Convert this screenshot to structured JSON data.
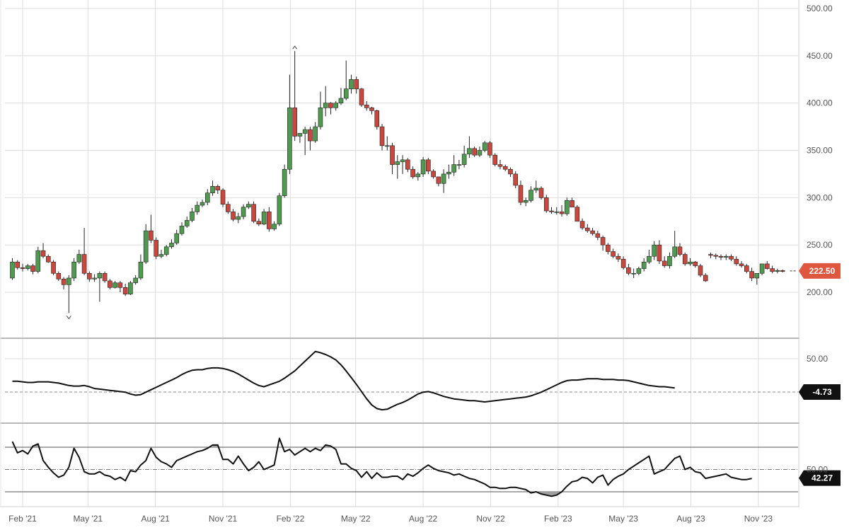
{
  "chart_data": [
    {
      "type": "candlestick",
      "name": "price-panel",
      "ylim": [
        200,
        500
      ],
      "yticks": [
        "500.00",
        "450.00",
        "400.00",
        "350.00",
        "300.00",
        "250.00",
        "200.00"
      ],
      "grid": true,
      "last_value": 222.5,
      "last_label": "222.50",
      "colors": {
        "up": "#4e9a4e",
        "down": "#c9473d",
        "wick": "#222222",
        "badge": "#e0573f"
      },
      "x": [
        "2021-01-18",
        "2021-01-25",
        "2021-02-01",
        "2021-02-08",
        "2021-02-15",
        "2021-02-22",
        "2021-03-01",
        "2021-03-08",
        "2021-03-15",
        "2021-03-22",
        "2021-03-29",
        "2021-04-05",
        "2021-04-12",
        "2021-04-19",
        "2021-04-26",
        "2021-05-03",
        "2021-05-10",
        "2021-05-17",
        "2021-05-24",
        "2021-05-31",
        "2021-06-07",
        "2021-06-14",
        "2021-06-21",
        "2021-06-28",
        "2021-07-05",
        "2021-07-12",
        "2021-07-19",
        "2021-07-26",
        "2021-08-02",
        "2021-08-09",
        "2021-08-16",
        "2021-08-23",
        "2021-08-30",
        "2021-09-06",
        "2021-09-13",
        "2021-09-20",
        "2021-09-27",
        "2021-10-04",
        "2021-10-11",
        "2021-10-18",
        "2021-10-25",
        "2021-11-01",
        "2021-11-08",
        "2021-11-15",
        "2021-11-22",
        "2021-11-29",
        "2021-12-06",
        "2021-12-13",
        "2021-12-20",
        "2021-12-27",
        "2022-01-03",
        "2022-01-10",
        "2022-01-17",
        "2022-01-24",
        "2022-01-31",
        "2022-02-07",
        "2022-02-14",
        "2022-02-21",
        "2022-02-28",
        "2022-03-07",
        "2022-03-14",
        "2022-03-21",
        "2022-03-28",
        "2022-04-04",
        "2022-04-11",
        "2022-04-18",
        "2022-04-25",
        "2022-05-02",
        "2022-05-09",
        "2022-05-16",
        "2022-05-23",
        "2022-05-30",
        "2022-06-06",
        "2022-06-13",
        "2022-06-20",
        "2022-06-27",
        "2022-07-04",
        "2022-07-11",
        "2022-07-18",
        "2022-07-25",
        "2022-08-01",
        "2022-08-08",
        "2022-08-15",
        "2022-08-22",
        "2022-08-29",
        "2022-09-05",
        "2022-09-12",
        "2022-09-19",
        "2022-09-26",
        "2022-10-03",
        "2022-10-10",
        "2022-10-17",
        "2022-10-24",
        "2022-10-31",
        "2022-11-07",
        "2022-11-14",
        "2022-11-21",
        "2022-11-28",
        "2022-12-05",
        "2022-12-12",
        "2022-12-19",
        "2022-12-26",
        "2023-01-02",
        "2023-01-09",
        "2023-01-16",
        "2023-01-23",
        "2023-01-30",
        "2023-02-06",
        "2023-02-13",
        "2023-02-20",
        "2023-02-27",
        "2023-03-06",
        "2023-03-13",
        "2023-03-20",
        "2023-03-27",
        "2023-04-03",
        "2023-04-10",
        "2023-04-17",
        "2023-04-24",
        "2023-05-01",
        "2023-05-08",
        "2023-05-15",
        "2023-05-22",
        "2023-05-29",
        "2023-06-05",
        "2023-06-12",
        "2023-06-19",
        "2023-06-26",
        "2023-07-03",
        "2023-07-10",
        "2023-07-17",
        "2023-07-24",
        "2023-07-31",
        "2023-08-07",
        "2023-08-14",
        "2023-08-21",
        "2023-08-28",
        "2023-09-04",
        "2023-09-11",
        "2023-09-18",
        "2023-09-25",
        "2023-10-02",
        "2023-10-09",
        "2023-10-16",
        "2023-10-23",
        "2023-10-30",
        "2023-11-06",
        "2023-11-13",
        "2023-11-20",
        "2023-11-27",
        "2023-12-04",
        "2023-12-11",
        "2023-12-18"
      ],
      "open": [
        215,
        232,
        226,
        225,
        228,
        222,
        244,
        238,
        232,
        220,
        214,
        208,
        215,
        232,
        240,
        220,
        214,
        215,
        220,
        212,
        205,
        210,
        205,
        198,
        210,
        215,
        232,
        265,
        255,
        238,
        240,
        248,
        252,
        262,
        270,
        276,
        285,
        292,
        295,
        305,
        312,
        308,
        293,
        285,
        277,
        280,
        290,
        293,
        275,
        272,
        285,
        267,
        272,
        302,
        330,
        395,
        365,
        368,
        372,
        360,
        375,
        395,
        400,
        395,
        400,
        405,
        415,
        425,
        415,
        398,
        395,
        392,
        375,
        355,
        355,
        335,
        338,
        340,
        330,
        322,
        325,
        340,
        328,
        322,
        315,
        325,
        327,
        335,
        335,
        346,
        352,
        345,
        350,
        358,
        345,
        335,
        333,
        330,
        325,
        313,
        295,
        297,
        308,
        310,
        300,
        286,
        285,
        285,
        283,
        297,
        290,
        275,
        268,
        265,
        262,
        258,
        250,
        243,
        238,
        235,
        226,
        220,
        220,
        225,
        232,
        238,
        250,
        233,
        228,
        238,
        248,
        240,
        230,
        232,
        228,
        218,
        240,
        239,
        238,
        237,
        238,
        235,
        230,
        228,
        222,
        215,
        220,
        230,
        225,
        222,
        223
      ],
      "close": [
        232,
        226,
        225,
        228,
        222,
        244,
        238,
        232,
        220,
        214,
        208,
        215,
        232,
        240,
        220,
        214,
        215,
        220,
        212,
        205,
        210,
        205,
        198,
        210,
        215,
        232,
        265,
        255,
        238,
        240,
        248,
        252,
        262,
        270,
        276,
        285,
        292,
        295,
        305,
        312,
        308,
        293,
        285,
        277,
        280,
        290,
        293,
        275,
        272,
        285,
        267,
        272,
        302,
        330,
        395,
        365,
        368,
        372,
        360,
        375,
        395,
        400,
        395,
        400,
        405,
        415,
        425,
        415,
        398,
        395,
        392,
        375,
        355,
        355,
        335,
        338,
        340,
        330,
        322,
        325,
        340,
        328,
        322,
        315,
        325,
        327,
        335,
        335,
        346,
        352,
        345,
        350,
        358,
        345,
        335,
        333,
        330,
        325,
        313,
        295,
        297,
        308,
        310,
        300,
        286,
        285,
        285,
        283,
        297,
        290,
        275,
        268,
        265,
        262,
        258,
        250,
        243,
        238,
        235,
        226,
        220,
        220,
        225,
        232,
        238,
        250,
        233,
        228,
        238,
        248,
        240,
        230,
        232,
        228,
        218,
        212,
        239,
        238,
        237,
        238,
        235,
        230,
        228,
        222,
        215,
        220,
        230,
        225,
        222,
        223,
        222
      ],
      "high": [
        236,
        234,
        230,
        230,
        230,
        248,
        252,
        240,
        234,
        222,
        216,
        218,
        236,
        245,
        268,
        222,
        219,
        222,
        222,
        214,
        212,
        212,
        209,
        212,
        218,
        240,
        272,
        282,
        258,
        245,
        250,
        256,
        266,
        274,
        280,
        289,
        296,
        298,
        309,
        318,
        314,
        310,
        296,
        288,
        284,
        293,
        296,
        296,
        278,
        288,
        290,
        275,
        305,
        335,
        430,
        455,
        368,
        375,
        375,
        380,
        412,
        418,
        401,
        402,
        416,
        445,
        430,
        428,
        416,
        402,
        396,
        393,
        378,
        365,
        358,
        345,
        345,
        342,
        333,
        327,
        343,
        342,
        330,
        322,
        330,
        335,
        345,
        340,
        355,
        365,
        354,
        354,
        360,
        360,
        347,
        340,
        335,
        332,
        328,
        318,
        300,
        312,
        318,
        312,
        303,
        290,
        290,
        292,
        300,
        300,
        292,
        278,
        272,
        268,
        265,
        260,
        252,
        246,
        241,
        238,
        230,
        225,
        227,
        236,
        245,
        254,
        255,
        238,
        242,
        265,
        252,
        242,
        236,
        233,
        230,
        220,
        242,
        241,
        240,
        240,
        240,
        238,
        233,
        230,
        226,
        218,
        222,
        233,
        228,
        225,
        224
      ],
      "low": [
        213,
        224,
        222,
        223,
        219,
        220,
        236,
        231,
        218,
        212,
        203,
        178,
        212,
        230,
        218,
        211,
        211,
        190,
        210,
        203,
        204,
        200,
        196,
        197,
        208,
        213,
        230,
        252,
        235,
        236,
        238,
        246,
        250,
        260,
        268,
        274,
        282,
        290,
        292,
        302,
        304,
        290,
        283,
        275,
        273,
        277,
        288,
        273,
        270,
        271,
        264,
        265,
        270,
        300,
        325,
        360,
        358,
        345,
        350,
        358,
        372,
        386,
        388,
        392,
        398,
        403,
        410,
        410,
        396,
        392,
        388,
        372,
        350,
        350,
        325,
        320,
        325,
        327,
        320,
        318,
        322,
        325,
        320,
        312,
        305,
        320,
        323,
        330,
        332,
        342,
        343,
        343,
        348,
        342,
        333,
        330,
        328,
        322,
        310,
        292,
        291,
        295,
        305,
        298,
        284,
        283,
        282,
        280,
        281,
        290,
        286,
        266,
        263,
        260,
        255,
        244,
        240,
        236,
        232,
        224,
        218,
        215,
        218,
        222,
        230,
        234,
        230,
        226,
        225,
        236,
        238,
        228,
        228,
        226,
        216,
        211,
        236,
        235,
        234,
        234,
        233,
        228,
        226,
        220,
        212,
        208,
        218,
        224,
        220,
        220,
        221
      ]
    },
    {
      "type": "line",
      "name": "oscillator-panel",
      "ylim": [
        -50,
        70
      ],
      "reference_line": -4.73,
      "yticks": [
        "50.00"
      ],
      "last_value": -4.73,
      "last_label": "-4.73",
      "colors": {
        "line": "#111111",
        "badge": "#111111"
      },
      "values": [
        13,
        13,
        12,
        11,
        11,
        12,
        12,
        12,
        11,
        10,
        8,
        6,
        5,
        5,
        6,
        4,
        1,
        0,
        -1,
        -2,
        -3,
        -4,
        -5,
        -8,
        -10,
        -9,
        -5,
        -1,
        3,
        7,
        11,
        15,
        19,
        24,
        28,
        31,
        32,
        32,
        34,
        35,
        35,
        34,
        32,
        29,
        25,
        20,
        15,
        10,
        6,
        4,
        7,
        10,
        13,
        18,
        24,
        30,
        38,
        46,
        54,
        62,
        60,
        57,
        53,
        48,
        40,
        30,
        19,
        8,
        -4,
        -16,
        -26,
        -32,
        -34,
        -33,
        -29,
        -25,
        -22,
        -18,
        -13,
        -8,
        -5,
        -4,
        -6,
        -9,
        -12,
        -14,
        -16,
        -17,
        -18,
        -19,
        -19,
        -20,
        -21,
        -20,
        -19,
        -18,
        -17,
        -16,
        -15,
        -14,
        -13,
        -11,
        -8,
        -5,
        -1,
        3,
        7,
        11,
        14,
        15,
        15,
        16,
        17,
        17,
        17,
        16,
        16,
        16,
        15,
        15,
        14,
        12,
        10,
        8,
        6,
        5,
        4,
        4,
        3,
        2
      ]
    },
    {
      "type": "line",
      "name": "momentum-panel",
      "ylim": [
        0,
        100
      ],
      "reference_lines": [
        30,
        50,
        70
      ],
      "yticks": [
        "50.00"
      ],
      "last_value": 42.27,
      "last_label": "42.27",
      "colors": {
        "line": "#111111",
        "fill": "#9e9e9e",
        "badge": "#111111"
      },
      "values": [
        75,
        65,
        67,
        64,
        71,
        73,
        58,
        52,
        47,
        43,
        45,
        52,
        69,
        61,
        48,
        46,
        46,
        48,
        45,
        44,
        41,
        43,
        40,
        49,
        48,
        54,
        58,
        69,
        61,
        57,
        55,
        52,
        58,
        60,
        62,
        64,
        66,
        67,
        69,
        72,
        72,
        59,
        59,
        55,
        62,
        55,
        49,
        52,
        57,
        50,
        52,
        54,
        78,
        66,
        68,
        63,
        66,
        69,
        66,
        69,
        67,
        72,
        71,
        68,
        55,
        55,
        51,
        49,
        43,
        48,
        42,
        47,
        43,
        43,
        44,
        44,
        41,
        46,
        44,
        47,
        51,
        54,
        51,
        49,
        48,
        47,
        45,
        46,
        44,
        42,
        41,
        39,
        37,
        34,
        34,
        33,
        33,
        34,
        34,
        33,
        32,
        29,
        30,
        28,
        27,
        26,
        27,
        30,
        35,
        39,
        40,
        43,
        42,
        38,
        43,
        45,
        36,
        41,
        44,
        46,
        50,
        53,
        56,
        59,
        62,
        46,
        48,
        50,
        55,
        60,
        62,
        50,
        52,
        48,
        47,
        42,
        43,
        44,
        45,
        46,
        43,
        42,
        41,
        41,
        42
      ],
      "xticks": [
        "Feb '21",
        "May '21",
        "Aug '21",
        "Nov '21",
        "Feb '22",
        "May '22",
        "Aug '22",
        "Nov '22",
        "Feb '23",
        "May '23",
        "Aug '23",
        "Nov '23"
      ]
    }
  ]
}
